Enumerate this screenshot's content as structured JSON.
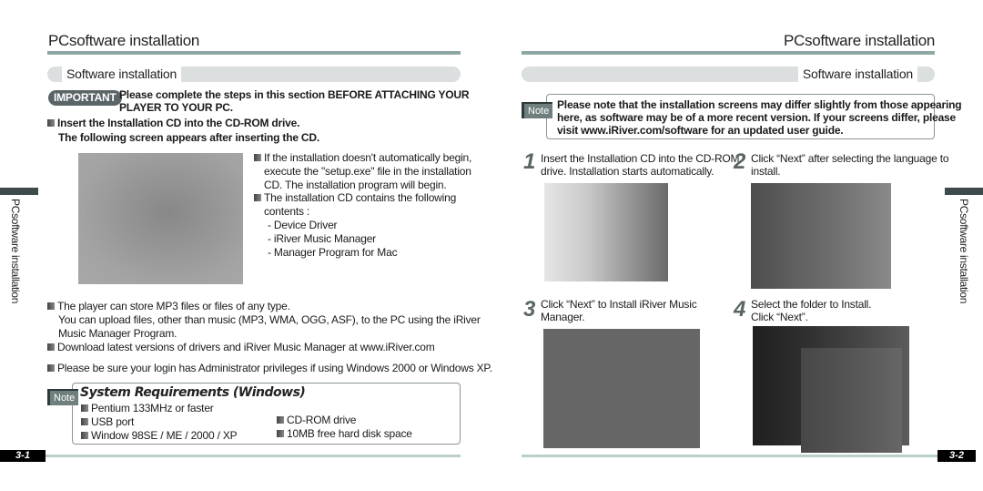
{
  "left_page": {
    "header": "PCsoftware installation",
    "section": "Software installation",
    "side_label": "PCsoftware installation",
    "important_badge": "IMPORTANT",
    "important_text_line1": "Please complete the steps in this section BEFORE ATTACHING YOUR",
    "important_text_line2": "PLAYER TO YOUR PC.",
    "insert_line1": "Insert the Installation CD into the CD-ROM drive.",
    "insert_line2": "The following screen appears after inserting the CD.",
    "screenshot_alt": "autorun-screen",
    "notes": [
      "If the installation doesn't automatically begin,",
      "execute the \"setup.exe\" file in the installation",
      "CD.   The installation program will begin.",
      "The installation CD contains the following",
      "contents :",
      "- Device Driver",
      "- iRiver Music Manager",
      "- Manager Program for Mac"
    ],
    "player_line1": "The player can store MP3 files or files of any type.",
    "player_line2": "You can upload files, other than music (MP3, WMA, OGG, ASF), to the PC  using the iRiver",
    "player_line3": "Music Manager Program.",
    "download_line": "Download latest versions of drivers and iRiver Music Manager at www.iRiver.com",
    "admin_line": "Please be sure your login has Administrator privileges if using Windows 2000 or Windows XP.",
    "note_badge": "Note",
    "sysreq_title": "System Requirements (Windows)",
    "sysreq_left": [
      "Pentium 133MHz or faster",
      "USB port",
      "Window 98SE / ME / 2000 / XP"
    ],
    "sysreq_right": [
      "CD-ROM drive",
      "10MB free hard disk space"
    ],
    "page_number": "3-1"
  },
  "right_page": {
    "header": "PCsoftware installation",
    "section": "Software installation",
    "side_label": "PCsoftware installation",
    "note_badge": "Note",
    "note_lines": [
      "Please note that the installation screens may differ slightly from those appearing",
      "here, as software may be of a more recent version. If your screens differ, please",
      "visit www.iRiver.com/software for an updated user guide."
    ],
    "steps": [
      {
        "number": "1",
        "line1": "Insert the Installation CD into the CD-ROM",
        "line2": "drive. Installation starts automatically."
      },
      {
        "number": "2",
        "line1": "Click “Next” after selecting the language to",
        "line2": "install."
      },
      {
        "number": "3",
        "line1": "Click “Next” to Install iRiver Music",
        "line2": "Manager."
      },
      {
        "number": "4",
        "line1": "Select the folder to Install.",
        "line2": "Click “Next”."
      }
    ],
    "page_number": "3-2"
  },
  "colors": {
    "rule": "#8fa7a4",
    "pill": "#dcdfdf",
    "badge": "#5b6467",
    "page_num_bg": "#000000"
  }
}
